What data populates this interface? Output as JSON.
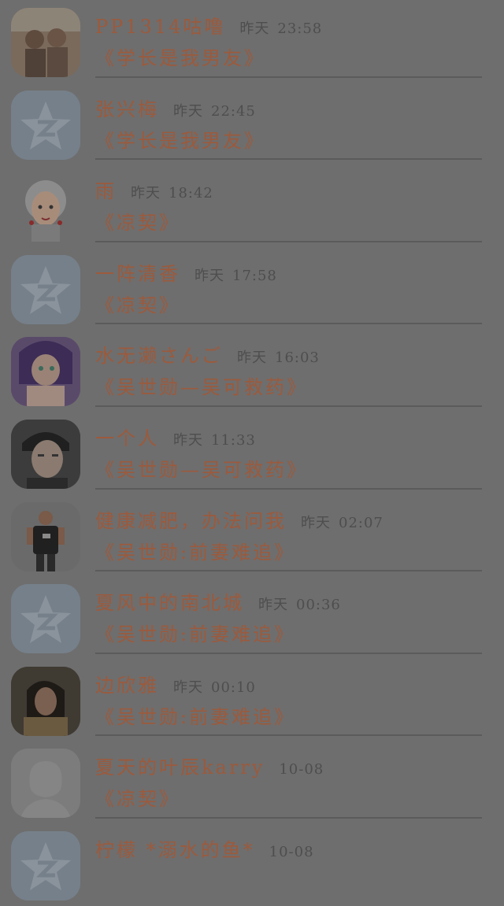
{
  "comments": [
    {
      "name": "PP1314咕噜",
      "day": "昨天",
      "time": "23:58",
      "book": "《学长是我男友》",
      "avatar": "photo-avatar-icon",
      "avatar_color": "#7a6a5c"
    },
    {
      "name": "张兴梅",
      "day": "昨天",
      "time": "22:45",
      "book": "《学长是我男友》",
      "avatar": "qq-star-avatar-icon",
      "avatar_color": "#76808a"
    },
    {
      "name": "雨",
      "day": "昨天",
      "time": "18:42",
      "book": "《凉契》",
      "avatar": "cartoon-avatar-icon",
      "avatar_color": "#707070"
    },
    {
      "name": "一阵清香",
      "day": "昨天",
      "time": "17:58",
      "book": "《凉契》",
      "avatar": "qq-star-avatar-icon",
      "avatar_color": "#76808a"
    },
    {
      "name": "水无濑さんご",
      "day": "昨天",
      "time": "16:03",
      "book": "《吴世勋—吴可救药》",
      "avatar": "anime-avatar-icon",
      "avatar_color": "#5a4a6a"
    },
    {
      "name": "一个人",
      "day": "昨天",
      "time": "11:33",
      "book": "《吴世勋—吴可救药》",
      "avatar": "photo-avatar-icon",
      "avatar_color": "#3c3c3c"
    },
    {
      "name": "健康减肥，办法问我",
      "day": "昨天",
      "time": "02:07",
      "book": "《吴世勋:前妻难追》",
      "avatar": "photo-avatar-icon",
      "avatar_color": "#6a6a6a"
    },
    {
      "name": "夏风中的南北城",
      "day": "昨天",
      "time": "00:36",
      "book": "《吴世勋:前妻难追》",
      "avatar": "qq-star-avatar-icon",
      "avatar_color": "#76808a"
    },
    {
      "name": "边欣雅",
      "day": "昨天",
      "time": "00:10",
      "book": "《吴世勋:前妻难追》",
      "avatar": "photo-avatar-icon",
      "avatar_color": "#3f3a32"
    },
    {
      "name": "夏天的叶辰karry",
      "day": "",
      "time": "10-08",
      "book": "《凉契》",
      "avatar": "default-person-avatar-icon",
      "avatar_color": "#7c7c7c"
    },
    {
      "name": "柠檬 *溺水的鱼*",
      "day": "",
      "time": "10-08",
      "book": "",
      "avatar": "qq-star-avatar-icon",
      "avatar_color": "#76808a"
    }
  ]
}
